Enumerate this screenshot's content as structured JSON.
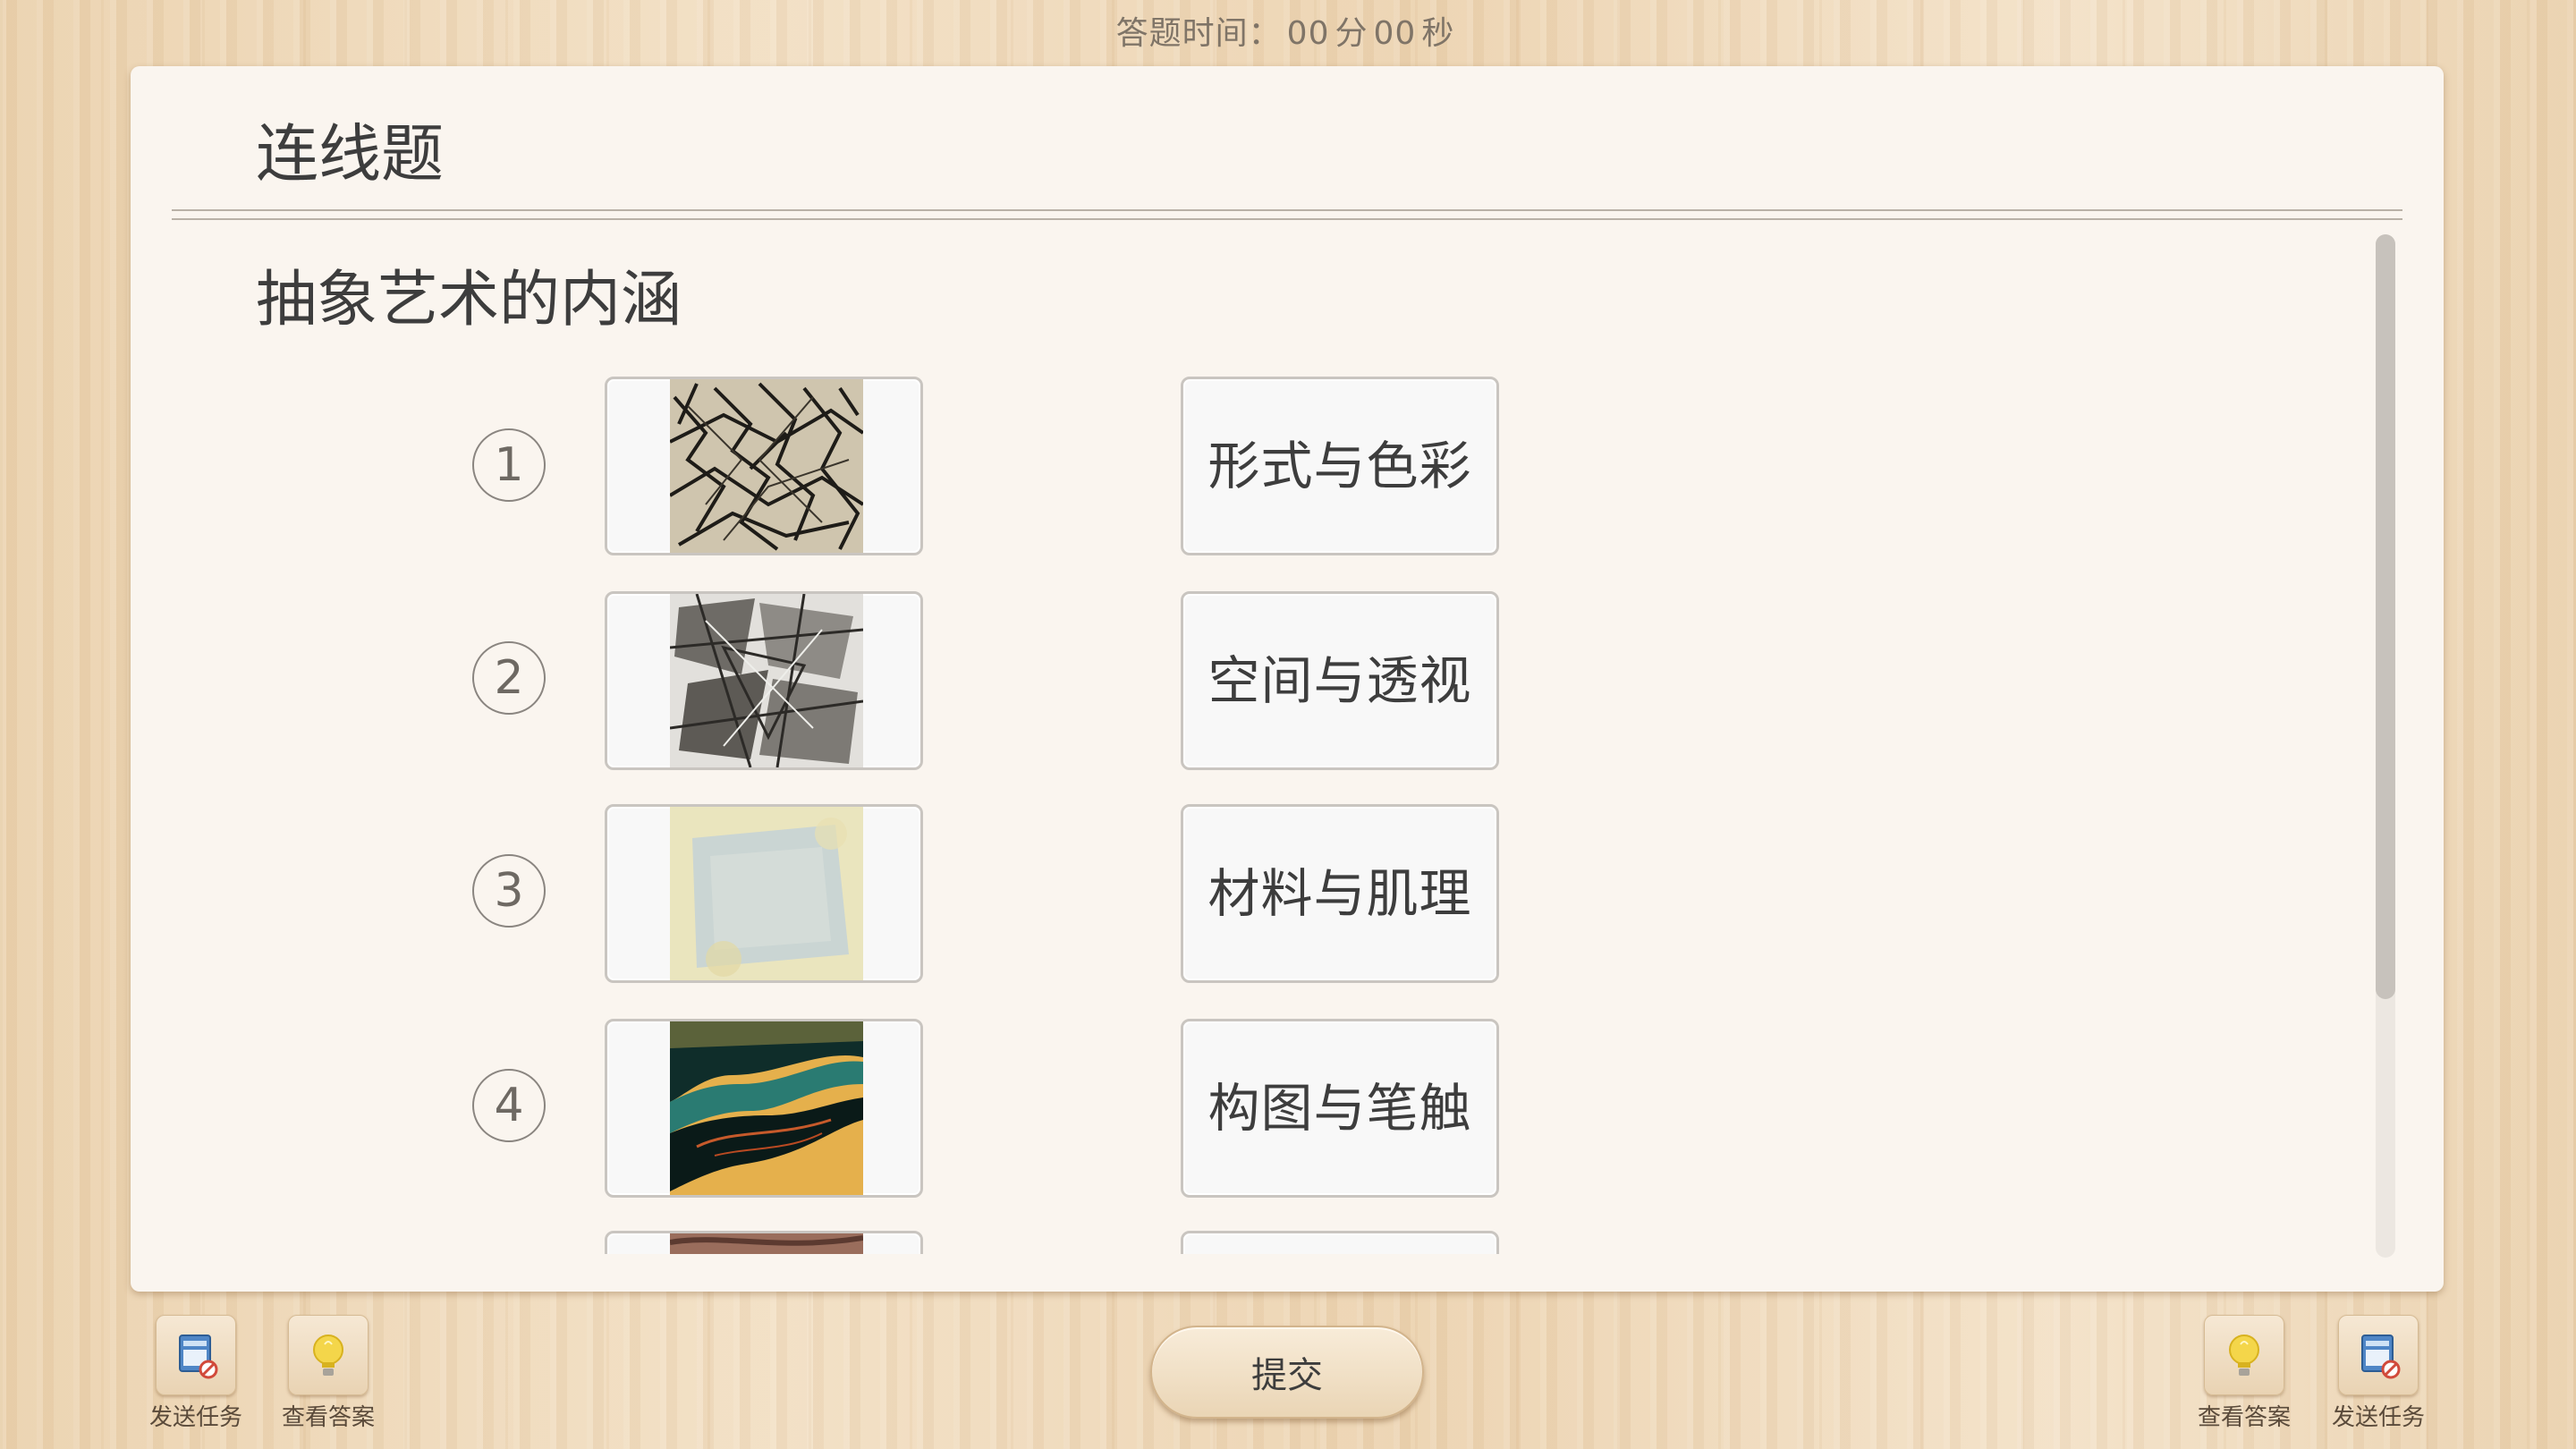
{
  "timer": {
    "label": "答题时间：",
    "minutes": "00",
    "minutes_unit": "分",
    "seconds": "00",
    "seconds_unit": "秒"
  },
  "panel": {
    "type_title": "连线题",
    "question": "抽象艺术的内涵",
    "scroll_position": 0
  },
  "rows": [
    {
      "number": "1",
      "artwork": "abstract-art-image-1",
      "answer": "形式与色彩"
    },
    {
      "number": "2",
      "artwork": "abstract-art-image-2",
      "answer": "空间与透视"
    },
    {
      "number": "3",
      "artwork": "abstract-art-image-3",
      "answer": "材料与肌理"
    },
    {
      "number": "4",
      "artwork": "abstract-art-image-4",
      "answer": "构图与笔触"
    }
  ],
  "toolbar": {
    "left": [
      {
        "label": "发送任务",
        "icon": "send-task-icon"
      },
      {
        "label": "查看答案",
        "icon": "lightbulb-icon"
      }
    ],
    "right": [
      {
        "label": "查看答案",
        "icon": "lightbulb-icon"
      },
      {
        "label": "发送任务",
        "icon": "send-task-icon"
      }
    ],
    "submit_label": "提交"
  },
  "colors": {
    "panel_bg": "#faf5ef",
    "text": "#3d3d3d",
    "wood": "#ecd5b3"
  }
}
